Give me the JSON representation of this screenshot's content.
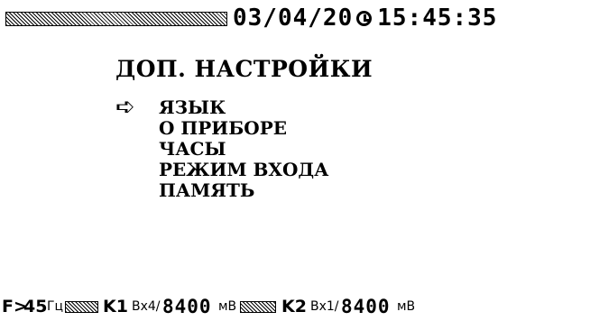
{
  "status": {
    "date": "03/04/20",
    "time": "15:45:35",
    "clock_icon": "clock-icon"
  },
  "menu": {
    "title": "ДОП. НАСТРОЙКИ",
    "pointer_icon": "arrow-right-icon",
    "selected_index": 0,
    "items": [
      {
        "label": "ЯЗЫК"
      },
      {
        "label": "О ПРИБОРЕ"
      },
      {
        "label": "ЧАСЫ"
      },
      {
        "label": "РЕЖИМ ВХОДА"
      },
      {
        "label": "ПАМЯТЬ"
      }
    ]
  },
  "footer": {
    "freq_prefix": "F>",
    "freq_value": "45",
    "freq_unit": "Гц",
    "k1": {
      "label": "K1",
      "input": "Вх4/",
      "value": "8400",
      "unit": "мВ"
    },
    "k2": {
      "label": "K2",
      "input": "Вх1/",
      "value": "8400",
      "unit": "мВ"
    }
  }
}
